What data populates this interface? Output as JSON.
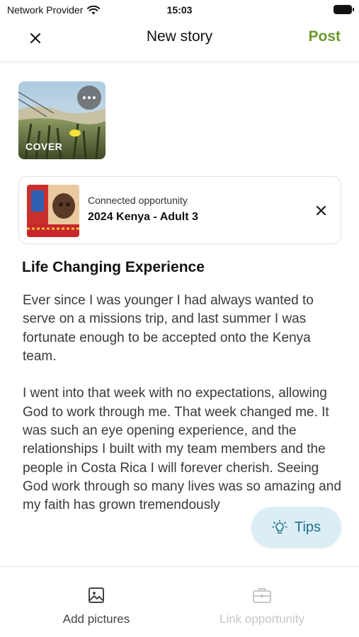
{
  "status_bar": {
    "carrier": "Network Provider",
    "time": "15:03"
  },
  "nav": {
    "title": "New story",
    "post_label": "Post",
    "accent": "#6a9a2c"
  },
  "cover": {
    "label": "COVER"
  },
  "opportunity": {
    "subtitle": "Connected opportunity",
    "title": "2024 Kenya - Adult 3"
  },
  "story": {
    "title": "Life Changing Experience",
    "body": "Ever since I was younger I had always wanted to serve on a missions trip, and last summer I was fortunate enough to be accepted onto the Kenya team.\n\nI went into that week with no expectations, allowing God to work through me. That week changed me. It was such an eye opening experience, and the relationships I built with my team members and the people in Costa Rica I will forever cherish. Seeing God work through so many lives was so amazing and my faith has grown tremendously"
  },
  "tips": {
    "label": "Tips"
  },
  "bottom_bar": {
    "add_pictures_label": "Add pictures",
    "link_opportunity_label": "Link opportunity"
  },
  "icons": [
    "wifi-icon",
    "battery-icon",
    "close-icon",
    "more-icon",
    "lightbulb-icon",
    "image-icon",
    "briefcase-icon"
  ]
}
